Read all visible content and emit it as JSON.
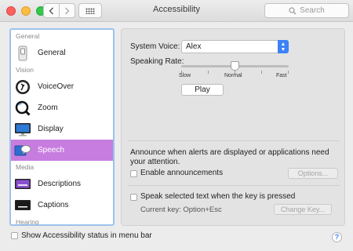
{
  "window": {
    "title": "Accessibility",
    "search_placeholder": "Search",
    "colors": {
      "selection": "#c77de0",
      "sidebar_focus": "#9cc2ec",
      "accent": "#3b82f6"
    }
  },
  "sidebar": {
    "sections": [
      {
        "label": "General",
        "items": [
          {
            "label": "General",
            "icon": "switch-icon"
          }
        ]
      },
      {
        "label": "Vision",
        "items": [
          {
            "label": "VoiceOver",
            "icon": "voiceover-icon"
          },
          {
            "label": "Zoom",
            "icon": "zoom-icon"
          },
          {
            "label": "Display",
            "icon": "display-icon"
          },
          {
            "label": "Speech",
            "icon": "speech-bubble-icon",
            "selected": true
          }
        ]
      },
      {
        "label": "Media",
        "items": [
          {
            "label": "Descriptions",
            "icon": "descriptions-icon"
          },
          {
            "label": "Captions",
            "icon": "captions-icon"
          }
        ]
      },
      {
        "label": "Hearing",
        "items": []
      }
    ]
  },
  "speech": {
    "system_voice_label": "System Voice:",
    "system_voice_value": "Alex",
    "speaking_rate_label": "Speaking Rate:",
    "rate_slow": "Slow",
    "rate_normal": "Normal",
    "rate_fast": "Fast",
    "rate_position": 0.5,
    "play_button": "Play",
    "announce_text": "Announce when alerts are displayed or applications need your attention.",
    "enable_announcements": "Enable announcements",
    "options_button": "Options...",
    "speak_selected": "Speak selected text when the key is pressed",
    "current_key": "Current key: Option+Esc",
    "change_key_button": "Change Key..."
  },
  "footer": {
    "show_status_label": "Show Accessibility status in menu bar",
    "help": "?"
  }
}
